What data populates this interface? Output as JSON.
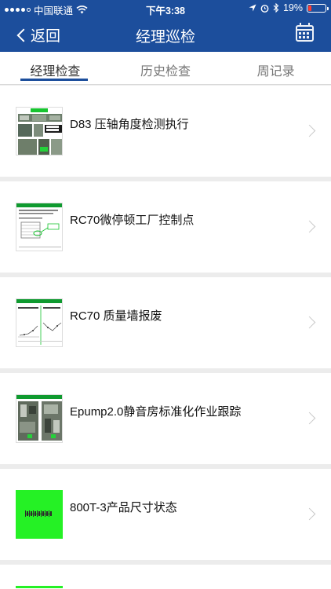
{
  "status_bar": {
    "carrier": "中国联通",
    "time": "下午3:38",
    "battery": "19%",
    "battery_level": 0.19,
    "wifi_icon": "wifi-icon",
    "location_icon": "location-icon",
    "alarm_icon": "alarm-icon",
    "bluetooth_icon": "bluetooth-icon"
  },
  "nav": {
    "back_label": "返回",
    "title": "经理巡检",
    "calendar_icon": "calendar-icon"
  },
  "tabs": [
    {
      "label": "经理检查",
      "active": true
    },
    {
      "label": "历史检查",
      "active": false
    },
    {
      "label": "周记录",
      "active": false
    }
  ],
  "items": [
    {
      "title": "D83 压轴角度检测执行",
      "thumb": "photo-collage"
    },
    {
      "title": "RC70微停顿工厂控制点",
      "thumb": "document-form"
    },
    {
      "title": "RC70 质量墙报废",
      "thumb": "line-chart-doc"
    },
    {
      "title": "Epump2.0静音房标准化作业跟踪",
      "thumb": "photo-pair"
    },
    {
      "title": "800T-3产品尺寸状态",
      "thumb": "green-slide"
    }
  ],
  "colors": {
    "header": "#1c4e9c",
    "accent_green": "#25f125",
    "background": "#ececec"
  }
}
